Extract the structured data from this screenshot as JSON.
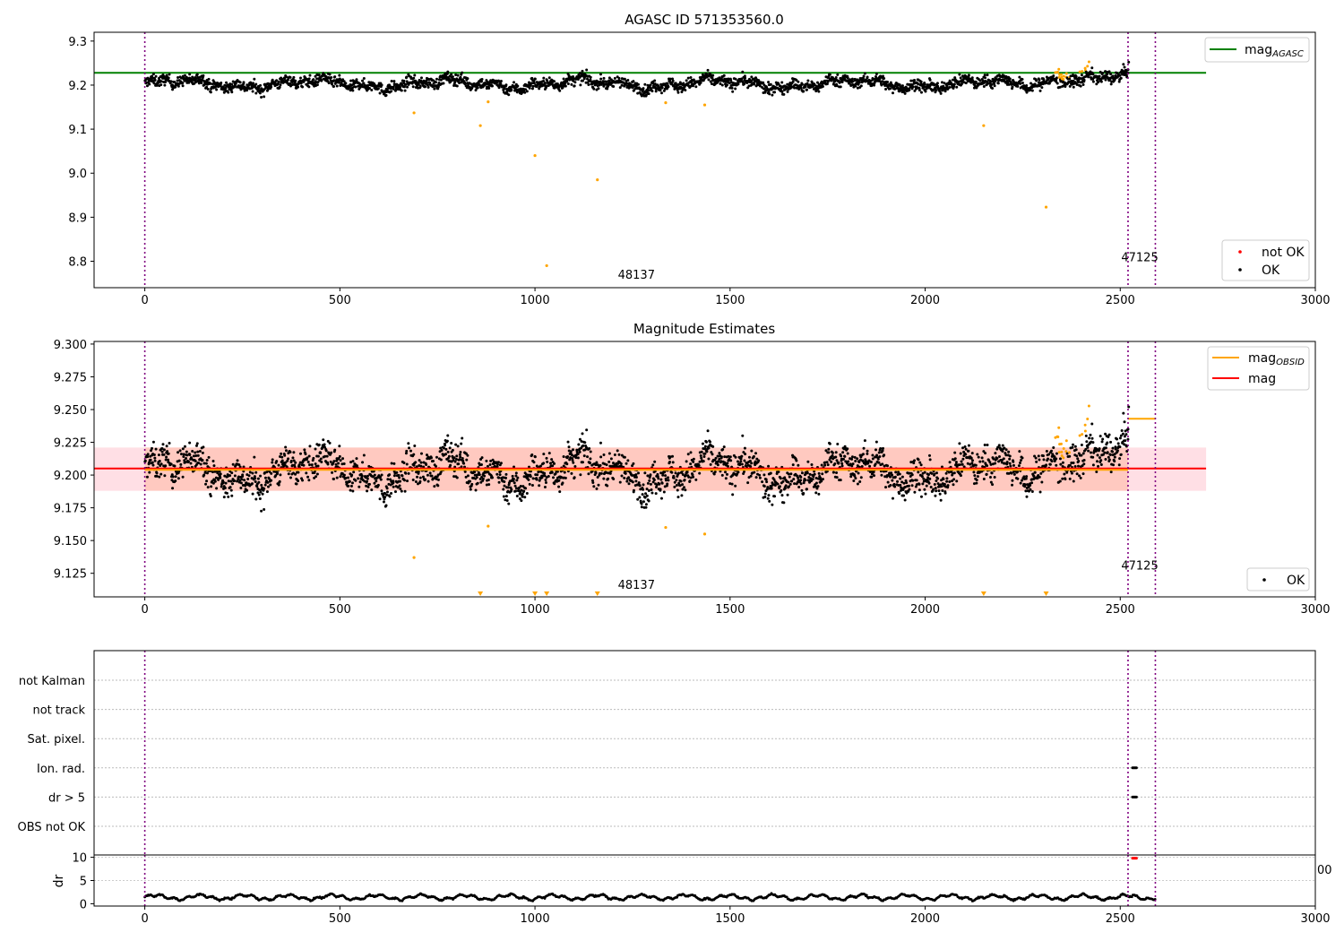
{
  "chart_data": [
    {
      "type": "scatter",
      "title": "AGASC ID 571353560.0",
      "xlim": [
        -130,
        3000
      ],
      "ylim": [
        8.74,
        9.32
      ],
      "xticks": [
        0,
        500,
        1000,
        1500,
        2000,
        2500,
        3000
      ],
      "yticks": [
        8.8,
        8.9,
        9.0,
        9.1,
        9.2,
        9.3
      ],
      "ytick_labels": [
        "8.8",
        "8.9",
        "9.0",
        "9.1",
        "9.2",
        "9.3"
      ],
      "vlines": [
        0,
        2520,
        2590
      ],
      "obsid_labels": [
        {
          "text": "48137",
          "x": 1260,
          "y": 8.76
        },
        {
          "text": "47125",
          "x": 2550,
          "y": 8.8
        }
      ],
      "hline": {
        "name": "mag",
        "sub": "AGASC",
        "y": 9.228,
        "x0": -130,
        "x1": 2720,
        "color": "#008000"
      },
      "ok_series": {
        "name": "OK",
        "color": "#000000",
        "segments": [
          [
            0,
            2520,
            9.203
          ],
          [
            2520,
            2590,
            9.243
          ]
        ]
      },
      "not_ok_series": {
        "name": "not OK",
        "color": "#ff0000"
      },
      "outliers": [
        [
          690,
          9.137
        ],
        [
          860,
          9.108
        ],
        [
          880,
          9.162
        ],
        [
          1000,
          9.04
        ],
        [
          1030,
          8.79
        ],
        [
          1160,
          8.985
        ],
        [
          1335,
          9.16
        ],
        [
          1435,
          9.155
        ],
        [
          2150,
          9.108
        ],
        [
          2310,
          8.923
        ]
      ],
      "outlier_color": "#ffa500"
    },
    {
      "type": "scatter",
      "title": "Magnitude Estimates",
      "xlim": [
        -130,
        3000
      ],
      "ylim": [
        9.107,
        9.302
      ],
      "xticks": [
        0,
        500,
        1000,
        1500,
        2000,
        2500,
        3000
      ],
      "yticks": [
        9.125,
        9.15,
        9.175,
        9.2,
        9.225,
        9.25,
        9.275,
        9.3
      ],
      "ytick_labels": [
        "9.125",
        "9.150",
        "9.175",
        "9.200",
        "9.225",
        "9.250",
        "9.275",
        "9.300"
      ],
      "vlines": [
        0,
        2520,
        2590
      ],
      "obsid_labels": [
        {
          "text": "48137",
          "x": 1260,
          "y": 9.113
        },
        {
          "text": "47125",
          "x": 2550,
          "y": 9.128
        }
      ],
      "mag_line": {
        "name": "mag",
        "y": 9.205,
        "x0": -130,
        "x1": 2720,
        "color": "#ff0000"
      },
      "mag_band": {
        "y0": 9.188,
        "y1": 9.221,
        "x0": -130,
        "x1": 2720,
        "color": "#ffc0cb"
      },
      "obsid_segments": [
        {
          "x0": 0,
          "x1": 2520,
          "y": 9.204,
          "y0": 9.188,
          "y1": 9.221
        },
        {
          "x0": 2520,
          "x1": 2590,
          "y": 9.243
        }
      ],
      "obsid_legend": {
        "name": "mag",
        "sub": "OBSID",
        "color": "#ffa500"
      },
      "ok_series": {
        "name": "OK",
        "color": "#000000"
      },
      "outliers": [
        [
          690,
          9.137
        ],
        [
          880,
          9.161
        ],
        [
          1335,
          9.16
        ],
        [
          1435,
          9.155
        ]
      ],
      "offscale_markers": [
        860,
        1000,
        1030,
        1160,
        2150,
        2310
      ]
    },
    {
      "type": "scatter",
      "title": "",
      "flag_categories": [
        "not Kalman",
        "not track",
        "Sat. pixel.",
        "Ion. rad.",
        "dr > 5",
        "OBS not OK"
      ],
      "flag_points": [
        {
          "category": "Ion. rad.",
          "x0": 2528,
          "x1": 2545
        },
        {
          "category": "dr > 5",
          "x0": 2528,
          "x1": 2545
        }
      ],
      "xlim": [
        -130,
        3000
      ],
      "vlines": [
        0,
        2520,
        2590
      ]
    },
    {
      "type": "line",
      "ylabel": "dr",
      "xlim": [
        -130,
        3000
      ],
      "ylim": [
        -0.5,
        10.5
      ],
      "xticks": [
        0,
        500,
        1000,
        1500,
        2000,
        2500,
        3000
      ],
      "yticks": [
        0,
        5,
        10
      ],
      "ytick_labels": [
        "0",
        "5",
        "10"
      ],
      "vlines": [
        0,
        2520,
        2590
      ],
      "dr_level": 1.4,
      "dr_high": {
        "x0": 2528,
        "x1": 2545,
        "y": 9.8,
        "color": "#ff0000"
      },
      "overlap_tick_text": "00"
    }
  ]
}
